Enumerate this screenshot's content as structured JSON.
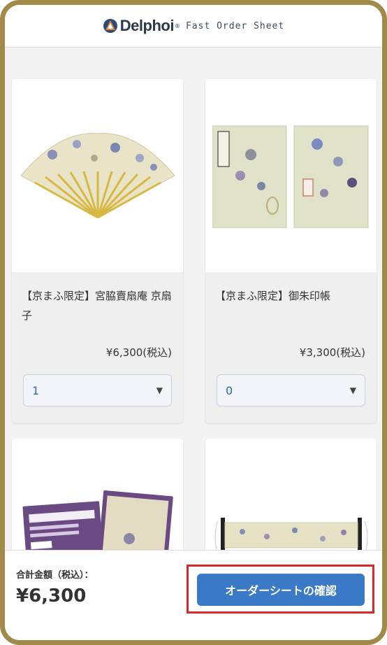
{
  "header": {
    "brand": "Delphoi",
    "registered": "®",
    "subtitle": "Fast Order Sheet"
  },
  "products": [
    {
      "name": "【京まふ限定】宮脇賣扇庵 京扇子",
      "price": "¥6,300(税込)",
      "quantity": "1"
    },
    {
      "name": "【京まふ限定】御朱印帳",
      "price": "¥3,300(税込)",
      "quantity": "0"
    },
    {
      "name": "",
      "price": "",
      "quantity": ""
    },
    {
      "name": "",
      "price": "",
      "quantity": ""
    }
  ],
  "footer": {
    "total_label": "合計金額（税込）：",
    "total_value": "¥6,300",
    "confirm_label": "オーダーシートの確認"
  },
  "colors": {
    "accent": "#3a79c6",
    "highlight_border": "#d9262a",
    "frame_border": "#a08a4a"
  }
}
